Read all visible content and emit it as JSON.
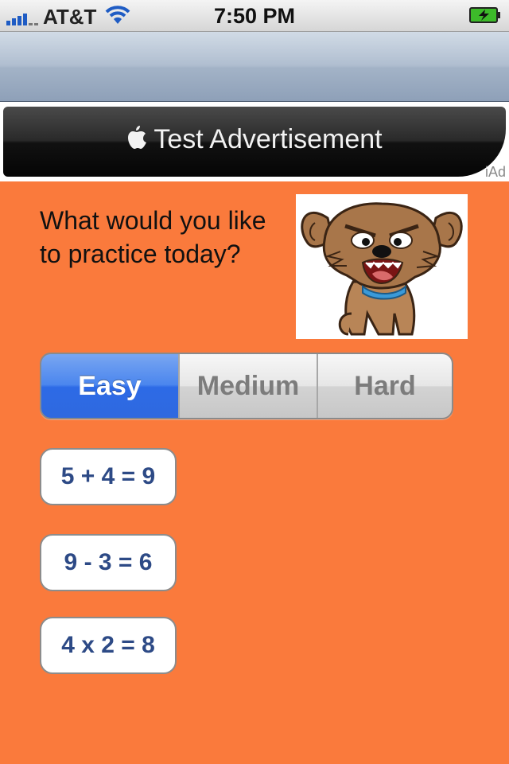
{
  "status_bar": {
    "carrier": "AT&T",
    "time": "7:50 PM",
    "icons": [
      "signal-bars-icon",
      "wifi-icon",
      "battery-charging-icon"
    ]
  },
  "ad": {
    "label": "Test Advertisement",
    "badge": "iAd",
    "icon": "apple-logo-icon"
  },
  "main": {
    "question": "What would you like to practice today?",
    "picture": "cartoon-dog"
  },
  "difficulty": {
    "segments": [
      "Easy",
      "Medium",
      "Hard"
    ],
    "selected": "Easy"
  },
  "problems": [
    "5 + 4 = 9",
    "9 - 3 = 6",
    "4 x 2 = 8"
  ],
  "colors": {
    "background": "#fa7a3c",
    "selected_segment": "#3b78ea",
    "problem_text": "#2d4a86"
  }
}
